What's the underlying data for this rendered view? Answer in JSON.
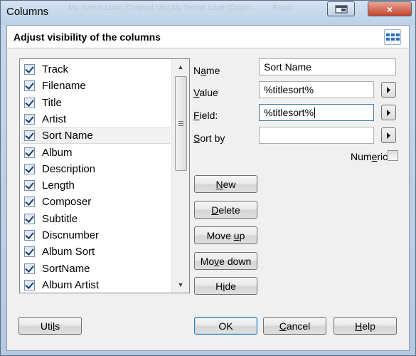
{
  "window": {
    "title": "Columns",
    "ghost_texts": [
      "My Sweet Love (Original Mix)",
      "My Sweet Love (Origin...",
      "Recor"
    ]
  },
  "dialog": {
    "header_title": "Adjust visibility of the columns",
    "columns": [
      {
        "label": "Track",
        "checked": true
      },
      {
        "label": "Filename",
        "checked": true
      },
      {
        "label": "Title",
        "checked": true
      },
      {
        "label": "Artist",
        "checked": true
      },
      {
        "label": "Sort Name",
        "checked": true,
        "selected": true
      },
      {
        "label": "Album",
        "checked": true
      },
      {
        "label": "Description",
        "checked": true
      },
      {
        "label": "Length",
        "checked": true
      },
      {
        "label": "Composer",
        "checked": true
      },
      {
        "label": "Subtitle",
        "checked": true
      },
      {
        "label": "Discnumber",
        "checked": true
      },
      {
        "label": "Album Sort",
        "checked": true
      },
      {
        "label": "SortName",
        "checked": true
      },
      {
        "label": "Album Artist",
        "checked": true
      }
    ],
    "fields": {
      "name": {
        "pre": "N",
        "acc": "a",
        "post": "me",
        "value": "Sort Name"
      },
      "value": {
        "pre": "",
        "acc": "V",
        "post": "alue",
        "value": "%titlesort%"
      },
      "field": {
        "pre": "",
        "acc": "F",
        "post": "ield:",
        "value": "%titlesort%"
      },
      "sort_by": {
        "pre": "",
        "acc": "S",
        "post": "ort by",
        "value": ""
      }
    },
    "numeric": {
      "pre": "Num",
      "acc": "e",
      "post": "ric",
      "checked": false
    },
    "buttons": {
      "new": {
        "pre": "",
        "acc": "N",
        "post": "ew"
      },
      "delete": {
        "pre": "",
        "acc": "D",
        "post": "elete"
      },
      "move_up": {
        "pre": "Move ",
        "acc": "u",
        "post": "p"
      },
      "move_down": {
        "pre": "Mo",
        "acc": "v",
        "post": "e down"
      },
      "hide": {
        "pre": "H",
        "acc": "i",
        "post": "de"
      },
      "utils": {
        "pre": "Uti",
        "acc": "l",
        "post": "s"
      },
      "ok": {
        "pre": "OK",
        "acc": "",
        "post": ""
      },
      "cancel": {
        "pre": "",
        "acc": "C",
        "post": "ancel"
      },
      "help": {
        "pre": "",
        "acc": "H",
        "post": "elp"
      }
    }
  },
  "icons": {
    "arrow": "triangle-right",
    "close": "×",
    "scroll_up": "▲",
    "scroll_down": "▼"
  }
}
